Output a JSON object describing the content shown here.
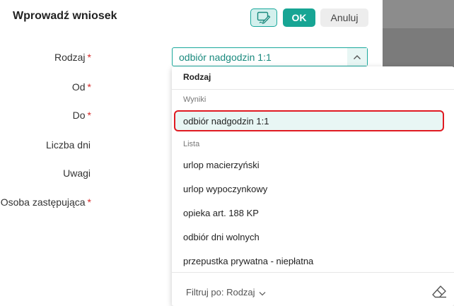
{
  "dialog": {
    "title": "Wprowadź wniosek",
    "ok_label": "OK",
    "cancel_label": "Anuluj"
  },
  "form": {
    "rodzaj_label": "Rodzaj",
    "od_label": "Od",
    "do_label": "Do",
    "liczba_dni_label": "Liczba dni",
    "uwagi_label": "Uwagi",
    "osoba_label": "Osoba zastępująca",
    "required_mark": "*",
    "rodzaj_value": "odbiór nadgodzin 1:1"
  },
  "dropdown": {
    "header": "Rodzaj",
    "results_group": "Wyniki",
    "selected_item": "odbiór nadgodzin 1:1",
    "list_group": "Lista",
    "items": [
      "urlop macierzyński",
      "urlop wypoczynkowy",
      "opieka art. 188 KP",
      "odbiór dni wolnych",
      "przepustka prywatna - niepłatna"
    ],
    "filter_label": "Filtruj po: Rodzaj"
  },
  "colors": {
    "accent": "#17a594",
    "required": "#d62828",
    "highlight_border": "#e01b22"
  }
}
